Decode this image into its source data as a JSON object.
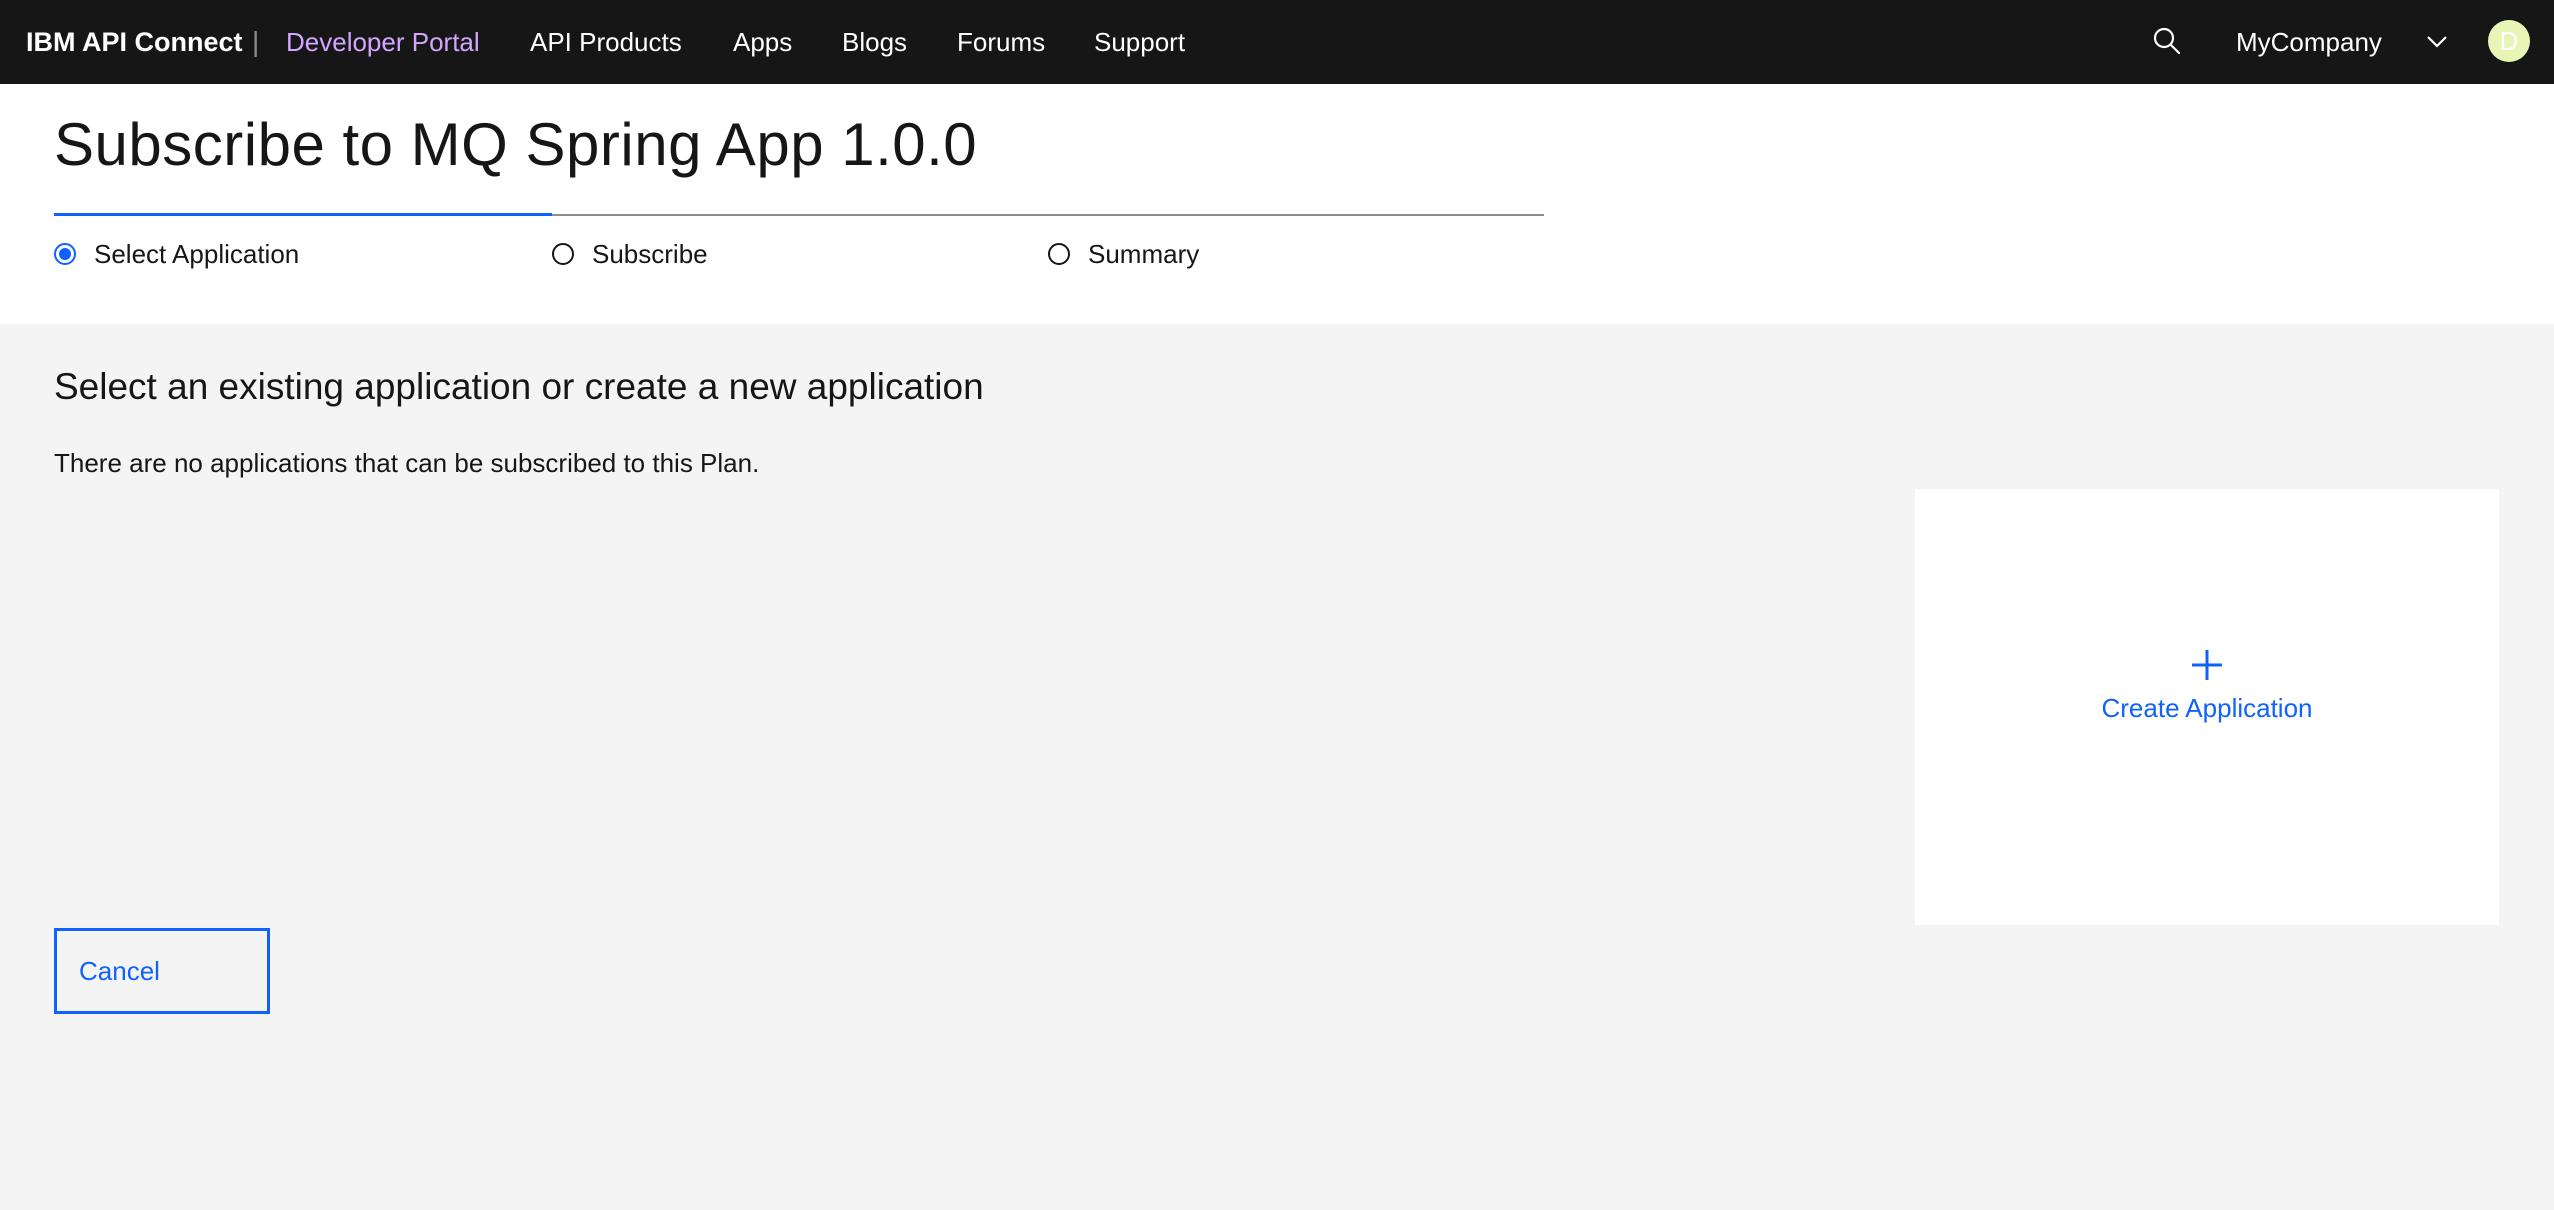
{
  "nav": {
    "brand": "IBM API Connect",
    "separator": "|",
    "portal": "Developer Portal",
    "items": [
      {
        "label": "API Products"
      },
      {
        "label": "Apps"
      },
      {
        "label": "Blogs"
      },
      {
        "label": "Forums"
      },
      {
        "label": "Support"
      }
    ],
    "search_icon": "search-icon",
    "org": "MyCompany",
    "org_icon": "chevron-down-icon",
    "avatar_initial": "D",
    "colors": {
      "background": "#161616",
      "portal_link": "#d4a5ff",
      "avatar": "#e8f5b6"
    }
  },
  "header": {
    "title": "Subscribe to MQ Spring App 1.0.0"
  },
  "steps": [
    {
      "label": "Select Application",
      "selected": true
    },
    {
      "label": "Subscribe",
      "selected": false
    },
    {
      "label": "Summary",
      "selected": false
    }
  ],
  "main": {
    "heading": "Select an existing application or create a new application",
    "empty_message": "There are no applications that can be subscribed to this Plan.",
    "create_card": {
      "icon": "plus-icon",
      "label": "Create Application"
    },
    "cancel_label": "Cancel"
  },
  "colors": {
    "accent": "#0f62fe",
    "page_background": "#f4f4f4"
  }
}
